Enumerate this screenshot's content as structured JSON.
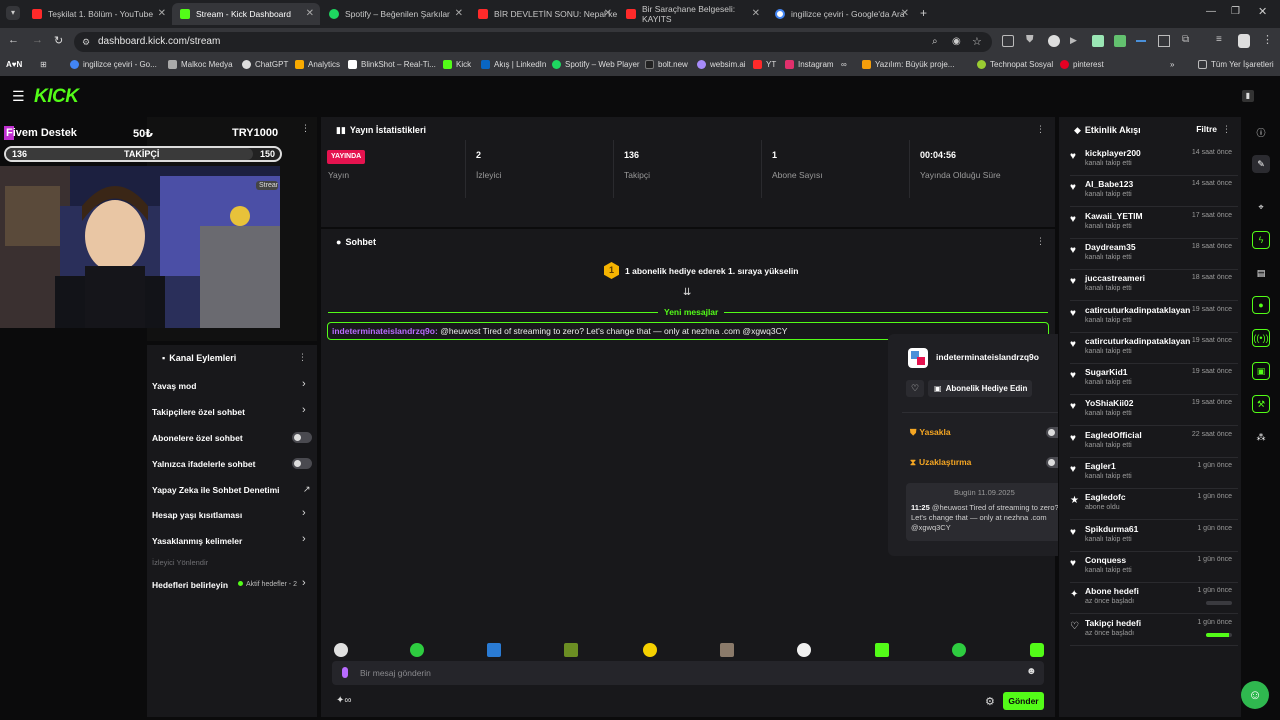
{
  "browser": {
    "tabs": [
      {
        "label": "Teşkilat 1. Bölüm - YouTube",
        "color": "#ff2a2a"
      },
      {
        "label": "Stream - Kick Dashboard",
        "color": "#53fc18",
        "active": true
      },
      {
        "label": "Spotify – Beğenilen Şarkılar",
        "color": "#1ed760"
      },
      {
        "label": "BİR DEVLETİN SONU: Nepal ke",
        "color": "#ff2a2a"
      },
      {
        "label": "Bir Saraçhane Belgeseli: KAYITS",
        "color": "#ff2a2a"
      },
      {
        "label": "ingilizce çeviri - Google'da Ara",
        "color": "#4285f4"
      }
    ],
    "url": "dashboard.kick.com/stream",
    "bookmarks": [
      "ingilizce çeviri - Go...",
      "Malkoc Medya",
      "ChatGPT",
      "Analytics",
      "BlinkShot – Real-Ti...",
      "Kick",
      "Akış | LinkedIn",
      "Spotify – Web Player",
      "bolt.new",
      "websim.ai",
      "YT",
      "Instagram",
      "Yazılım: Büyük proje...",
      "Technopat Sosyal",
      "pinterest"
    ],
    "all_bookmarks": "Tüm Yer İşaretleri"
  },
  "overlay": {
    "title": "Fivem Destek",
    "amount": "50₺",
    "currency_total": "TRY1000",
    "followers_current": "136",
    "followers_label": "TAKİPÇİ",
    "followers_goal": "150",
    "badge": "Streaming"
  },
  "stats": {
    "header": "Yayın İstatistikleri",
    "live_badge": "YAYINDA",
    "live_label": "Yayın",
    "viewers": "2",
    "viewers_label": "İzleyici",
    "followers": "136",
    "followers_label": "Takipçi",
    "subs": "1",
    "subs_label": "Abone Sayısı",
    "uptime": "00:04:56",
    "uptime_label": "Yayında Olduğu Süre"
  },
  "chat": {
    "header": "Sohbet",
    "gift_prompt": "1 abonelik hediye ederek 1. sıraya yükselin",
    "gift_rank": "1",
    "new_messages": "Yeni mesajlar",
    "message_user": "indeterminateislandrzq9o:",
    "message_text": "@heuwost Tired of streaming to zero? Let's change that — only at nezhna .com @xgwq3CY",
    "input_placeholder": "Bir mesaj gönderin",
    "send_button": "Gönder"
  },
  "actions": {
    "header": "Kanal Eylemleri",
    "items": [
      {
        "label": "Yavaş mod",
        "type": "chevron"
      },
      {
        "label": "Takipçilere özel sohbet",
        "type": "chevron"
      },
      {
        "label": "Abonelere özel sohbet",
        "type": "toggle"
      },
      {
        "label": "Yalnızca ifadelerle sohbet",
        "type": "toggle"
      },
      {
        "label": "Yapay Zeka ile Sohbet Denetimi",
        "type": "external"
      },
      {
        "label": "Hesap yaşı kısıtlaması",
        "type": "chevron"
      },
      {
        "label": "Yasaklanmış kelimeler",
        "type": "chevron"
      }
    ],
    "section_label": "İzleyici Yönlendir",
    "goals_label": "Hedefleri belirleyin",
    "goals_badge": "Aktif hedefler - 2"
  },
  "popup": {
    "username": "indeterminateislandrzq9o",
    "gift_button": "Abonelik Hediye Edin",
    "ban_label": "Yasakla",
    "timeout_label": "Uzaklaştırma",
    "date_label": "Bugün 11.09.2025",
    "log_time": "11:25",
    "log_text": "@heuwost Tired of streaming to zero? Let's change that — only at nezhna .com @xgwq3CY"
  },
  "feed": {
    "header": "Etkinlik Akışı",
    "filter": "Filtre",
    "items": [
      {
        "name": "kickplayer200",
        "action": "kanalı takip etti",
        "time": "14 saat önce"
      },
      {
        "name": "AI_Babe123",
        "action": "kanalı takip etti",
        "time": "14 saat önce"
      },
      {
        "name": "Kawaii_YETIM",
        "action": "kanalı takip etti",
        "time": "17 saat önce"
      },
      {
        "name": "Daydream35",
        "action": "kanalı takip etti",
        "time": "18 saat önce"
      },
      {
        "name": "juccastreameri",
        "action": "kanalı takip etti",
        "time": "18 saat önce"
      },
      {
        "name": "catircuturkadinpataklayan",
        "action": "kanalı takip etti",
        "time": "19 saat önce"
      },
      {
        "name": "catircuturkadinpataklayan",
        "action": "kanalı takip etti",
        "time": "19 saat önce"
      },
      {
        "name": "SugarKid1",
        "action": "kanalı takip etti",
        "time": "19 saat önce"
      },
      {
        "name": "YoShiaKii02",
        "action": "kanalı takip etti",
        "time": "19 saat önce"
      },
      {
        "name": "EagledOfficial",
        "action": "kanalı takip etti",
        "time": "22 saat önce"
      },
      {
        "name": "Eagler1",
        "action": "kanalı takip etti",
        "time": "1 gün önce"
      },
      {
        "name": "Eagledofc",
        "action": "abone oldu",
        "time": "1 gün önce"
      },
      {
        "name": "Spikdurma61",
        "action": "kanalı takip etti",
        "time": "1 gün önce"
      },
      {
        "name": "Conquess",
        "action": "kanalı takip etti",
        "time": "1 gün önce"
      }
    ],
    "goals": [
      {
        "name": "Abone hedefi",
        "status": "az önce başladı",
        "time": "1 gün önce",
        "progress": 0
      },
      {
        "name": "Takipçi hedefi",
        "status": "az önce başladı",
        "time": "1 gün önce",
        "progress": 0.9
      }
    ]
  },
  "colors": {
    "brand": "#53fc18",
    "live": "#e5134f",
    "panel": "#18181b"
  }
}
